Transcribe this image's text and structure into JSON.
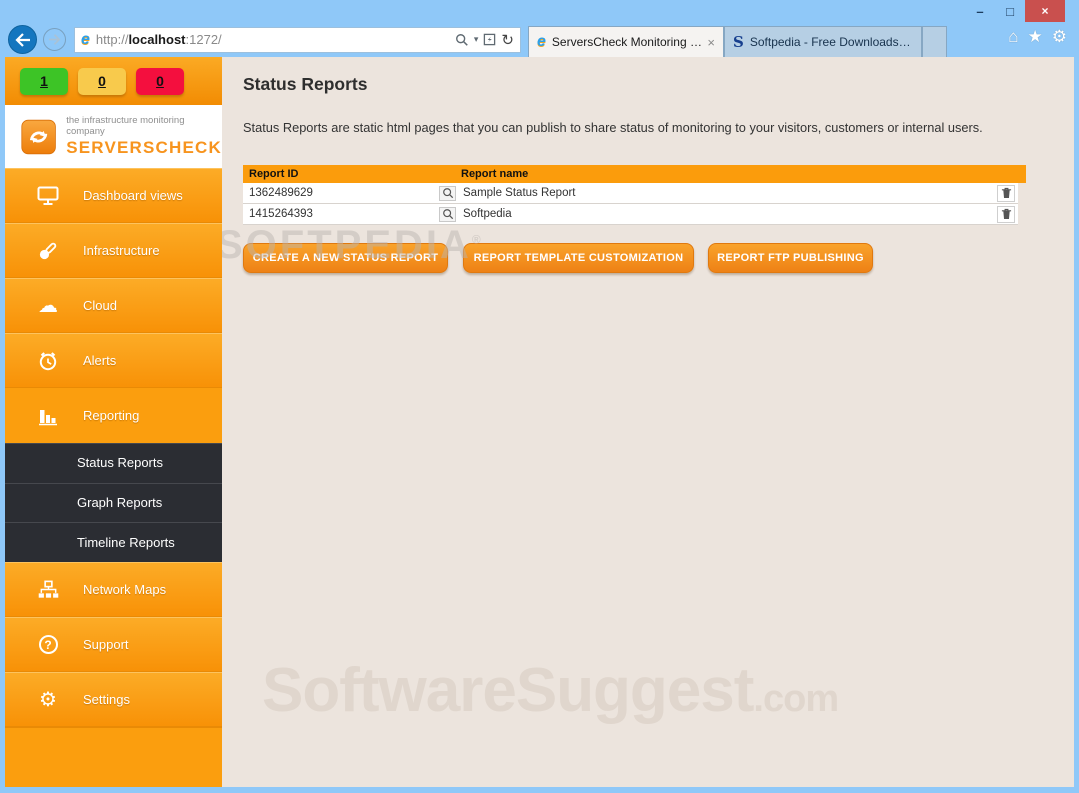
{
  "browser": {
    "window_controls": {
      "minimize": "–",
      "maximize": "□",
      "close": "×"
    },
    "address": {
      "prefix": "http://",
      "host": "localhost",
      "suffix": ":1272/"
    },
    "tabs": [
      {
        "label": "ServersCheck Monitoring S...",
        "favicon": "e",
        "close": "×",
        "active": true
      },
      {
        "label": "Softpedia - Free Downloads En...",
        "favicon": "S",
        "active": false
      }
    ],
    "toolbar_icons": {
      "home": "⌂",
      "favorites": "★",
      "tools": "⚙",
      "search_caret": "▾",
      "refresh": "↻"
    }
  },
  "sidebar": {
    "status_badges": [
      {
        "value": "1",
        "color": "#3dc426"
      },
      {
        "value": "0",
        "color": "#f8ca4c"
      },
      {
        "value": "0",
        "color": "#f40f3e"
      }
    ],
    "logo": {
      "tagline": "the infrastructure monitoring company",
      "brand": "SERVERSCHECK"
    },
    "menu": [
      {
        "label": "Dashboard views",
        "icon": "monitor-icon",
        "active": false
      },
      {
        "label": "Infrastructure",
        "icon": "thermometer-icon",
        "active": false
      },
      {
        "label": "Cloud",
        "icon": "cloud-icon",
        "glyph": "☁",
        "active": false
      },
      {
        "label": "Alerts",
        "icon": "alarm-clock-icon",
        "active": false
      },
      {
        "label": "Reporting",
        "icon": "bar-chart-icon",
        "active": true
      },
      {
        "label": "Network Maps",
        "icon": "network-icon",
        "active": false
      },
      {
        "label": "Support",
        "icon": "question-icon",
        "glyph": "?",
        "active": false
      },
      {
        "label": "Settings",
        "icon": "gear-icon",
        "glyph": "⚙",
        "active": false
      }
    ],
    "submenu": [
      {
        "label": "Status Reports",
        "active": true
      },
      {
        "label": "Graph Reports",
        "active": false
      },
      {
        "label": "Timeline Reports",
        "active": false
      }
    ]
  },
  "main": {
    "page_title": "Status Reports",
    "description": "Status Reports are static html pages that you can publish to share status of monitoring to your visitors, customers or internal users.",
    "table": {
      "columns": [
        "Report ID",
        "Report name"
      ],
      "rows": [
        {
          "report_id": "1362489629",
          "report_name": "Sample Status Report"
        },
        {
          "report_id": "1415264393",
          "report_name": "Softpedia"
        }
      ]
    },
    "action_buttons": [
      "CREATE A NEW STATUS REPORT",
      "REPORT TEMPLATE CUSTOMIZATION",
      "REPORT FTP PUBLISHING"
    ],
    "watermarks": {
      "softpedia": "SOFTPEDIA",
      "softpedia_reg": "®",
      "software_suggest": "SoftwareSuggest",
      "software_suggest_tld": ".com"
    }
  },
  "colors": {
    "chrome_blue": "#8fc8f8",
    "accent_orange": "#f7941e",
    "flat_orange": "#fb9e0e",
    "table_header_orange": "#fb9c0c",
    "submenu_dark": "#2b2d33",
    "content_bg": "#ece4dd",
    "badge_green": "#3dc426",
    "badge_yellow": "#f8ca4c",
    "badge_red": "#f40f3e",
    "close_red": "#c9504e"
  }
}
